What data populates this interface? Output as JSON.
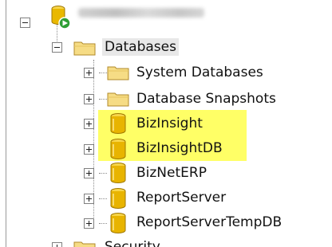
{
  "tree": {
    "server": {
      "icon": "sql-server-running-icon"
    },
    "databases_folder": {
      "label": "Databases",
      "icon": "folder-icon",
      "expanded": true
    },
    "children": [
      {
        "label": "System Databases",
        "icon": "folder-icon",
        "highlighted": false
      },
      {
        "label": "Database Snapshots",
        "icon": "folder-icon",
        "highlighted": false
      },
      {
        "label": "BizInsight",
        "icon": "database-icon",
        "highlighted": true
      },
      {
        "label": "BizInsightDB",
        "icon": "database-icon",
        "highlighted": true
      },
      {
        "label": "BizNetERP",
        "icon": "database-icon",
        "highlighted": false
      },
      {
        "label": "ReportServer",
        "icon": "database-icon",
        "highlighted": false
      },
      {
        "label": "ReportServerTempDB",
        "icon": "database-icon",
        "highlighted": false
      }
    ],
    "next_folder": {
      "label": "Security",
      "icon": "folder-icon"
    }
  },
  "colors": {
    "highlight": "#ffff66",
    "folder": "#f4d97a",
    "database": "#e8b400"
  }
}
